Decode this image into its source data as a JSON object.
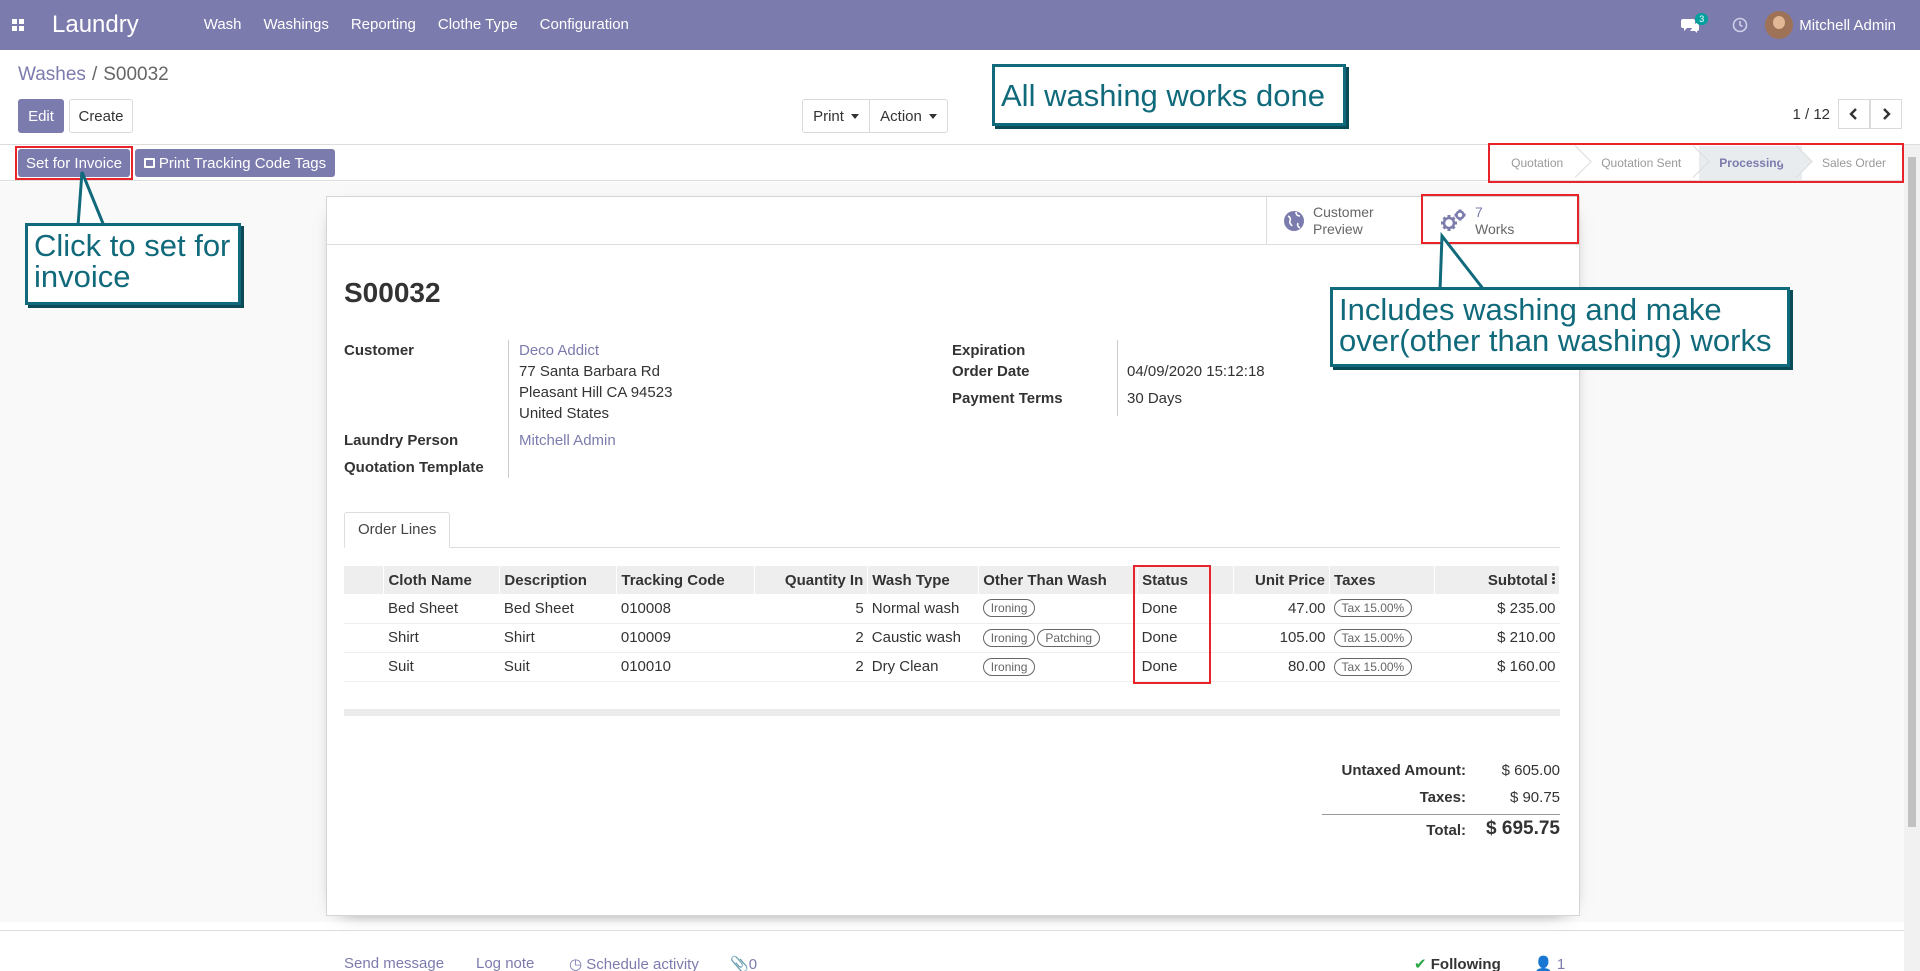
{
  "app": {
    "brand": "Laundry",
    "menu": [
      "Wash",
      "Washings",
      "Reporting",
      "Clothe Type",
      "Configuration"
    ],
    "chat_badge": "3",
    "user_name": "Mitchell Admin"
  },
  "breadcrumb": {
    "parent": "Washes",
    "separator": "/",
    "current": "S00032"
  },
  "control": {
    "edit_label": "Edit",
    "create_label": "Create",
    "print_label": "Print",
    "action_label": "Action",
    "pager_value": "1 / 12"
  },
  "statusbar": {
    "set_invoice_label": "Set for Invoice",
    "print_tags_label": "Print Tracking Code Tags",
    "stages": [
      {
        "label": "Quotation",
        "active": false
      },
      {
        "label": "Quotation Sent",
        "active": false
      },
      {
        "label": "Processing",
        "active": true
      },
      {
        "label": "Sales Order",
        "active": false
      }
    ]
  },
  "smart_buttons": {
    "customer_preview_line1": "Customer",
    "customer_preview_line2": "Preview",
    "works_count": "7",
    "works_label": "Works"
  },
  "order": {
    "name": "S00032",
    "customer_label": "Customer",
    "customer_name": "Deco Addict",
    "address_line1": "77 Santa Barbara Rd",
    "address_line2": "Pleasant Hill CA 94523",
    "address_line3": "United States",
    "laundry_person_label": "Laundry Person",
    "laundry_person": "Mitchell Admin",
    "quotation_template_label": "Quotation Template",
    "expiration_label": "Expiration",
    "order_date_label": "Order Date",
    "order_date": "04/09/2020 15:12:18",
    "payment_terms_label": "Payment Terms",
    "payment_terms": "30 Days"
  },
  "tabs": {
    "order_lines": "Order Lines"
  },
  "lines": {
    "headers": {
      "cloth_name": "Cloth Name",
      "description": "Description",
      "tracking_code": "Tracking Code",
      "quantity_in": "Quantity In",
      "wash_type": "Wash Type",
      "other_than_wash": "Other Than Wash",
      "status": "Status",
      "unit_price": "Unit Price",
      "taxes": "Taxes",
      "subtotal": "Subtotal"
    },
    "rows": [
      {
        "cloth": "Bed Sheet",
        "desc": "Bed Sheet",
        "code": "010008",
        "qty": "5",
        "wash": "Normal wash",
        "other1": "Ironing",
        "other2": "",
        "status": "Done",
        "price": "47.00",
        "tax": "Tax 15.00%",
        "subtotal": "$ 235.00"
      },
      {
        "cloth": "Shirt",
        "desc": "Shirt",
        "code": "010009",
        "qty": "2",
        "wash": "Caustic wash",
        "other1": "Ironing",
        "other2": "Patching",
        "status": "Done",
        "price": "105.00",
        "tax": "Tax 15.00%",
        "subtotal": "$ 210.00"
      },
      {
        "cloth": "Suit",
        "desc": "Suit",
        "code": "010010",
        "qty": "2",
        "wash": "Dry Clean",
        "other1": "Ironing",
        "other2": "",
        "status": "Done",
        "price": "80.00",
        "tax": "Tax 15.00%",
        "subtotal": "$ 160.00"
      }
    ]
  },
  "totals": {
    "untaxed_label": "Untaxed Amount:",
    "untaxed": "$ 605.00",
    "taxes_label": "Taxes:",
    "taxes": "$ 90.75",
    "total_label": "Total:",
    "total": "$ 695.75"
  },
  "chatter": {
    "send_message": "Send message",
    "log_note": "Log note",
    "schedule_activity": "Schedule activity",
    "attachments": "0",
    "following": "Following",
    "followers": "1"
  },
  "annotations": {
    "all_done": "All washing works done",
    "set_invoice_line1": "Click to set for",
    "set_invoice_line2": "invoice",
    "works_line1": "Includes washing and make",
    "works_line2": "over(other than washing) works"
  },
  "colors": {
    "brand": "#7c7bad",
    "annotation": "#116a7b",
    "highlight": "#e8232a"
  }
}
